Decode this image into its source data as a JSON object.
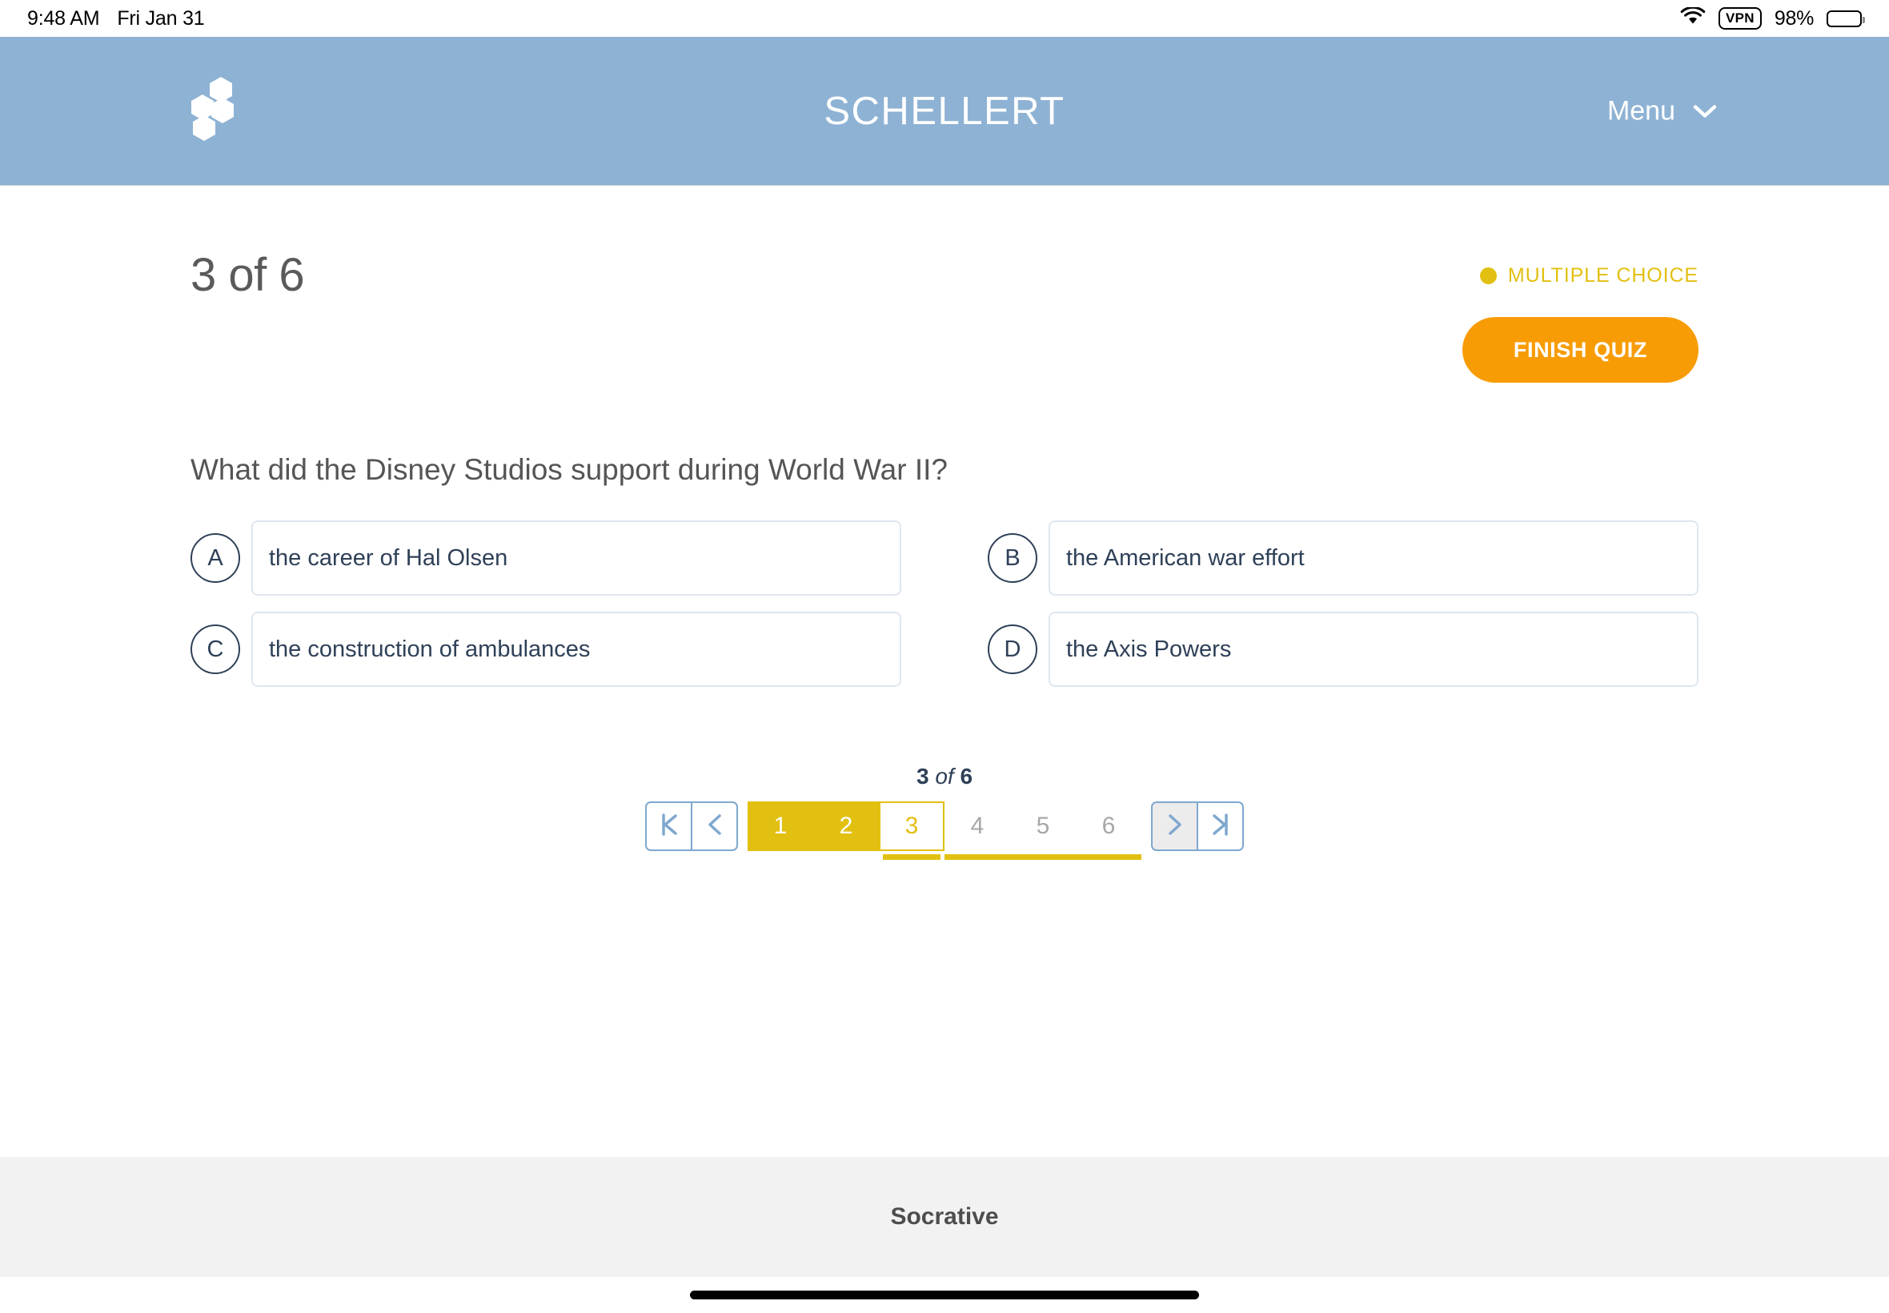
{
  "status_bar": {
    "time": "9:48 AM",
    "date": "Fri Jan 31",
    "wifi_icon": "wifi-icon",
    "vpn_label": "VPN",
    "battery_percent": "98%",
    "battery_icon": "battery-full-icon"
  },
  "header": {
    "logo_icon": "socrative-hexagon-logo",
    "title": "SCHELLERT",
    "menu_label": "Menu",
    "menu_icon": "chevron-down-icon",
    "background_color": "#8eb2d3"
  },
  "quiz": {
    "progress_heading": "3 of 6",
    "question_type": "MULTIPLE CHOICE",
    "question_type_color": "#e2c011",
    "finish_button_label": "FINISH QUIZ",
    "finish_button_color": "#f89c06",
    "question_text": "What did the Disney Studios support during World War II?",
    "answers": [
      {
        "letter": "A",
        "text": "the career of Hal Olsen"
      },
      {
        "letter": "B",
        "text": "the American war effort"
      },
      {
        "letter": "C",
        "text": "the construction of ambulances"
      },
      {
        "letter": "D",
        "text": "the Axis Powers"
      }
    ]
  },
  "pager": {
    "label_current": "3",
    "label_of": "of",
    "label_total": "6",
    "first_icon": "first-page-icon",
    "prev_icon": "previous-page-icon",
    "next_icon": "next-page-icon",
    "last_icon": "last-page-icon",
    "pages": [
      {
        "number": "1",
        "state": "done"
      },
      {
        "number": "2",
        "state": "done"
      },
      {
        "number": "3",
        "state": "current"
      },
      {
        "number": "4",
        "state": "todo"
      },
      {
        "number": "5",
        "state": "todo"
      },
      {
        "number": "6",
        "state": "todo"
      }
    ]
  },
  "footer": {
    "brand": "Socrative"
  }
}
